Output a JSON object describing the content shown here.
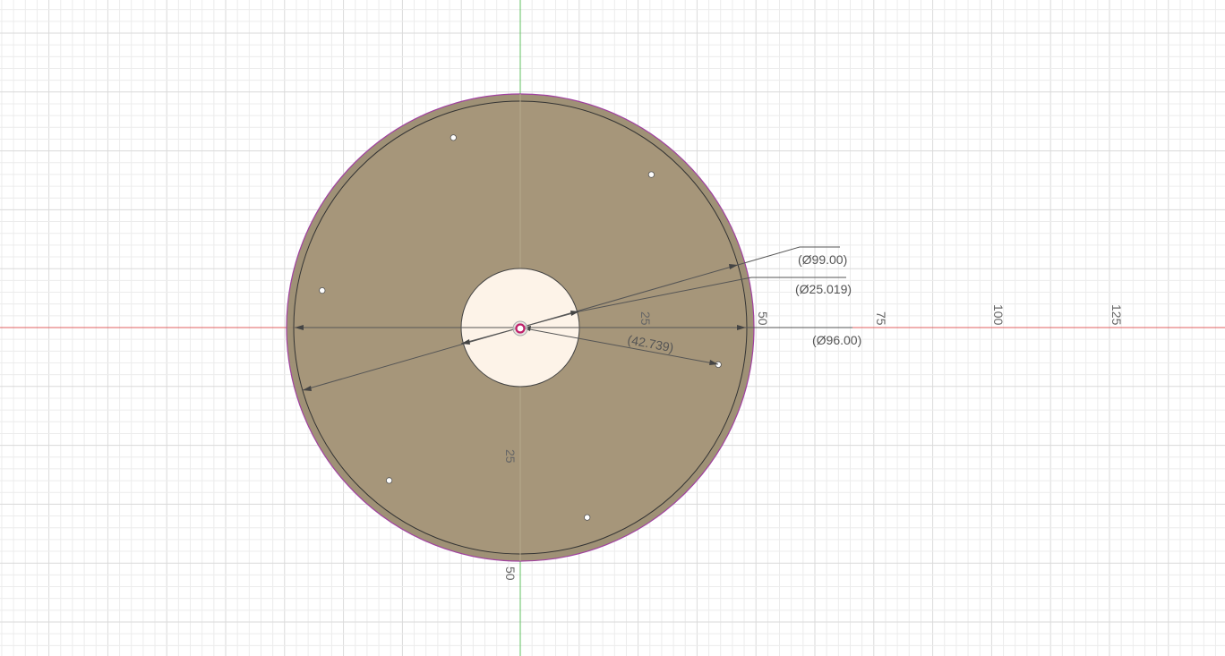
{
  "colors": {
    "background": "#ffffff",
    "grid_minor": "#ececec",
    "grid_major": "#dadada",
    "x_axis": "#e06060",
    "y_axis": "#60c060",
    "body_fill": "#9a8b6f",
    "inner_fill": "#a6977b",
    "bore_fill": "#fdf3e8",
    "dimension_line": "#555555",
    "origin_marker": "#c0206a"
  },
  "scale_unit": "mm",
  "axis_labels": {
    "x_ticks": [
      "25",
      "50",
      "75",
      "100",
      "125"
    ],
    "y_ticks": [
      "25",
      "50"
    ]
  },
  "dimensions": {
    "outer_diameter": "(Ø99.00)",
    "bore_diameter": "(Ø25.019)",
    "inner_diameter": "(Ø96.00)",
    "hole_offset": "(42.739)"
  },
  "model": {
    "outer_diameter_mm": 99.0,
    "inner_diameter_mm": 96.0,
    "bore_diameter_mm": 25.019,
    "mounting_hole_count": 6,
    "mounting_hole_radius_mm": 42.739
  }
}
